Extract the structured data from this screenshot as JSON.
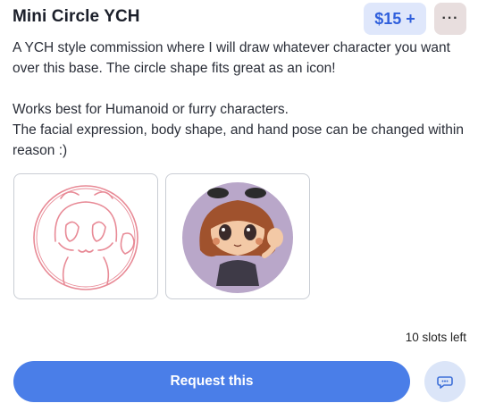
{
  "commission": {
    "title": "Mini Circle YCH",
    "price": "$15 +",
    "more_label": "···",
    "description": {
      "paragraph1": "A YCH style commission where I will draw whatever character you want over this base. The circle shape fits great as an icon!",
      "line2": "Works best for Humanoid or furry characters.",
      "line3": "The facial expression, body shape, and hand pose can be changed within reason :)"
    },
    "thumbnails": [
      {
        "icon": "sketch-base-image"
      },
      {
        "icon": "finished-example-image"
      }
    ],
    "slots_text": "10 slots left",
    "request_label": "Request this",
    "chat_icon": "chat-icon"
  },
  "colors": {
    "accent": "#4a7ee8",
    "price_bg": "#dfe7fb",
    "price_text": "#2f5fdc",
    "sketch_line": "#e88a96",
    "example_bg": "#b9a7c9"
  }
}
